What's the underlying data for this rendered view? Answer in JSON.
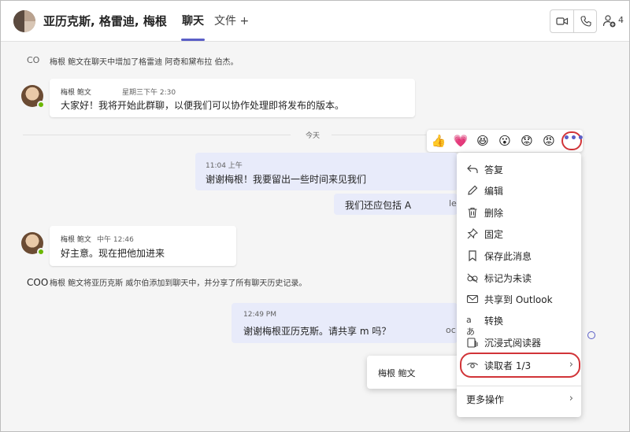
{
  "header": {
    "title": "亚历克斯, 格雷迪, 梅根",
    "tabs": [
      {
        "label": "聊天",
        "active": true
      },
      {
        "label": "文件",
        "active": false
      }
    ],
    "add_tab_glyph": "+",
    "participant_count": "4"
  },
  "system_messages": {
    "added": "梅根 鲍文在聊天中增加了格雷迪 阿奇和黛布拉 伯杰。",
    "added_prefix": "CO",
    "history": "梅根 鲍文将亚历克斯 威尔伯添加到聊天中，并分享了所有聊天历史记录。",
    "history_prefix": "COO"
  },
  "messages": [
    {
      "sender": "梅根 鲍文",
      "time": "星期三下午 2:30",
      "text": "大家好！我将开始此群聊，以便我们可以协作处理即将发布的版本。"
    },
    {
      "time": "11:04 上午",
      "text": "谢谢梅根！我要留出一些时间来见我们",
      "mine": true
    },
    {
      "text": "我们还应包括 A",
      "trailing": "le",
      "mine": true
    },
    {
      "sender": "梅根 鲍文",
      "time": "中午 12:46",
      "text": "好主意。现在把他加进来"
    },
    {
      "time": "12:49 PM",
      "text": "谢谢梅根亚历克斯。请共享 m 吗？",
      "trailing": "oc",
      "mine": true
    }
  ],
  "divider": {
    "label": "今天"
  },
  "reactions": [
    "like",
    "heart",
    "laugh",
    "surprised",
    "sad",
    "angry"
  ],
  "more_options_label": "•••",
  "menu": {
    "items": [
      {
        "label": "答复",
        "icon": "reply-icon"
      },
      {
        "label": "编辑",
        "icon": "edit-icon"
      },
      {
        "label": "删除",
        "icon": "delete-icon"
      },
      {
        "label": "固定",
        "icon": "pin-icon"
      },
      {
        "label": "保存此消息",
        "icon": "bookmark-icon"
      },
      {
        "label": "标记为未读",
        "icon": "mark-unread-icon"
      },
      {
        "label": "共享到 Outlook",
        "icon": "mail-icon"
      },
      {
        "label": "转换",
        "icon": "translate-icon"
      },
      {
        "label": "沉浸式阅读器",
        "icon": "immersive-reader-icon"
      },
      {
        "label": "读取者 1/3",
        "icon": "eye-icon",
        "submenu": true
      },
      {
        "label": "更多操作",
        "icon": "",
        "submenu": true
      }
    ],
    "chevron": "›"
  },
  "readers_popup": {
    "name": "梅根 鲍文"
  },
  "colors": {
    "accent": "#5b5fc7",
    "highlight": "#d13438",
    "mine_bubble": "#e8ebfa",
    "online": "#6bb700"
  }
}
